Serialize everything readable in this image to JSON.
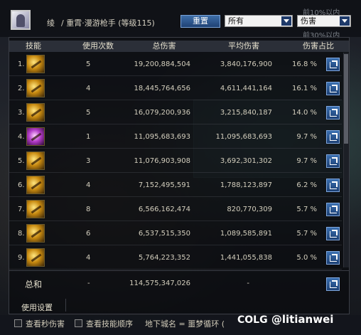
{
  "header": {
    "class_prefix": "绫",
    "class_name": "/ 重霄·漫游枪手 (等级115)",
    "reset_label": "重置",
    "filter_value": "所有",
    "sort_value": "伤害",
    "hint_top": "前10%以内",
    "hint_bottom": "前30%以内"
  },
  "columns": [
    "技能",
    "使用次数",
    "总伤害",
    "平均伤害",
    "伤害占比"
  ],
  "rows": [
    {
      "rank": "1.",
      "uses": "5",
      "total": "19,200,884,504",
      "avg": "3,840,176,900",
      "pct": "16.8 %",
      "icon": "gold-skill-icon"
    },
    {
      "rank": "2.",
      "uses": "4",
      "total": "18,445,764,656",
      "avg": "4,611,441,164",
      "pct": "16.1 %",
      "icon": "gold-skill-icon"
    },
    {
      "rank": "3.",
      "uses": "5",
      "total": "16,079,200,936",
      "avg": "3,215,840,187",
      "pct": "14.0 %",
      "icon": "gold-skill-icon"
    },
    {
      "rank": "4.",
      "uses": "1",
      "total": "11,095,683,693",
      "avg": "11,095,683,693",
      "pct": "9.7 %",
      "icon": "purple-skill-icon"
    },
    {
      "rank": "5.",
      "uses": "3",
      "total": "11,076,903,908",
      "avg": "3,692,301,302",
      "pct": "9.7 %",
      "icon": "gold-skill-icon"
    },
    {
      "rank": "6.",
      "uses": "4",
      "total": "7,152,495,591",
      "avg": "1,788,123,897",
      "pct": "6.2 %",
      "icon": "gold-skill-icon"
    },
    {
      "rank": "7.",
      "uses": "8",
      "total": "6,566,162,474",
      "avg": "820,770,309",
      "pct": "5.7 %",
      "icon": "gold-skill-icon"
    },
    {
      "rank": "8.",
      "uses": "6",
      "total": "6,537,515,350",
      "avg": "1,089,585,891",
      "pct": "5.7 %",
      "icon": "gold-skill-icon"
    },
    {
      "rank": "9.",
      "uses": "4",
      "total": "5,764,223,352",
      "avg": "1,441,055,838",
      "pct": "5.0 %",
      "icon": "gold-skill-icon"
    }
  ],
  "totals": {
    "label": "总和",
    "uses": "-",
    "total": "114,575,347,026",
    "avg": "-"
  },
  "footer": {
    "settings_label": "使用设置",
    "check_dps_label": "查看秒伤害",
    "check_order_label": "查看技能顺序",
    "dungeon_text": "地下城名 = 噩梦循环 (",
    "watermark_logo": "COLG",
    "watermark_user": "@litianwei"
  },
  "colors": {
    "accent_blue": "#2a5a9a",
    "header_bg": "#2b2f38",
    "text": "#d3cebd"
  }
}
